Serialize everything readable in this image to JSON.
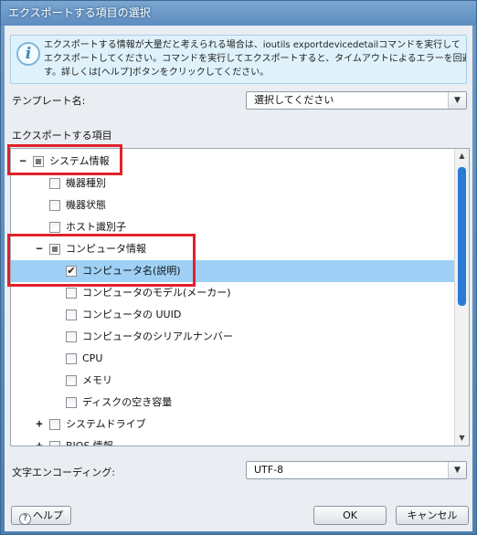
{
  "window": {
    "title": "エクスポートする項目の選択"
  },
  "info": {
    "icon": "i",
    "lines": [
      "エクスポートする情報が大量だと考えられる場合は、ioutils exportdevicedetailコマンドを実行して",
      "エクスポートしてください。コマンドを実行してエクスポートすると、タイムアウトによるエラーを回避できま",
      "す。詳しくは[ヘルプ]ボタンをクリックしてください。"
    ]
  },
  "template": {
    "label": "テンプレート名:",
    "value": "選択してください"
  },
  "tree_label": "エクスポートする項目",
  "tree": [
    {
      "label": "システム情報",
      "expander": "−",
      "check": "partial"
    },
    {
      "label": "機器種別",
      "expander": "",
      "check": "off"
    },
    {
      "label": "機器状態",
      "expander": "",
      "check": "off"
    },
    {
      "label": "ホスト識別子",
      "expander": "",
      "check": "off"
    },
    {
      "label": "コンピュータ情報",
      "expander": "−",
      "check": "partial"
    },
    {
      "label": "コンピュータ名(説明)",
      "expander": "",
      "check": "on"
    },
    {
      "label": "コンピュータのモデル(メーカー)",
      "expander": "",
      "check": "off"
    },
    {
      "label": "コンピュータの UUID",
      "expander": "",
      "check": "off"
    },
    {
      "label": "コンピュータのシリアルナンバー",
      "expander": "",
      "check": "off"
    },
    {
      "label": "CPU",
      "expander": "",
      "check": "off"
    },
    {
      "label": "メモリ",
      "expander": "",
      "check": "off"
    },
    {
      "label": "ディスクの空き容量",
      "expander": "",
      "check": "off"
    },
    {
      "label": "システムドライブ",
      "expander": "+",
      "check": "off"
    },
    {
      "label": "BIOS 情報",
      "expander": "+",
      "check": "off"
    }
  ],
  "encoding": {
    "label": "文字エンコーディング:",
    "value": "UTF-8"
  },
  "buttons": {
    "help": "ヘルプ",
    "ok": "OK",
    "cancel": "キャンセル"
  },
  "colors": {
    "highlight": "#e0222b",
    "selection": "#9fd0f5",
    "accent": "#2b7bd6"
  }
}
